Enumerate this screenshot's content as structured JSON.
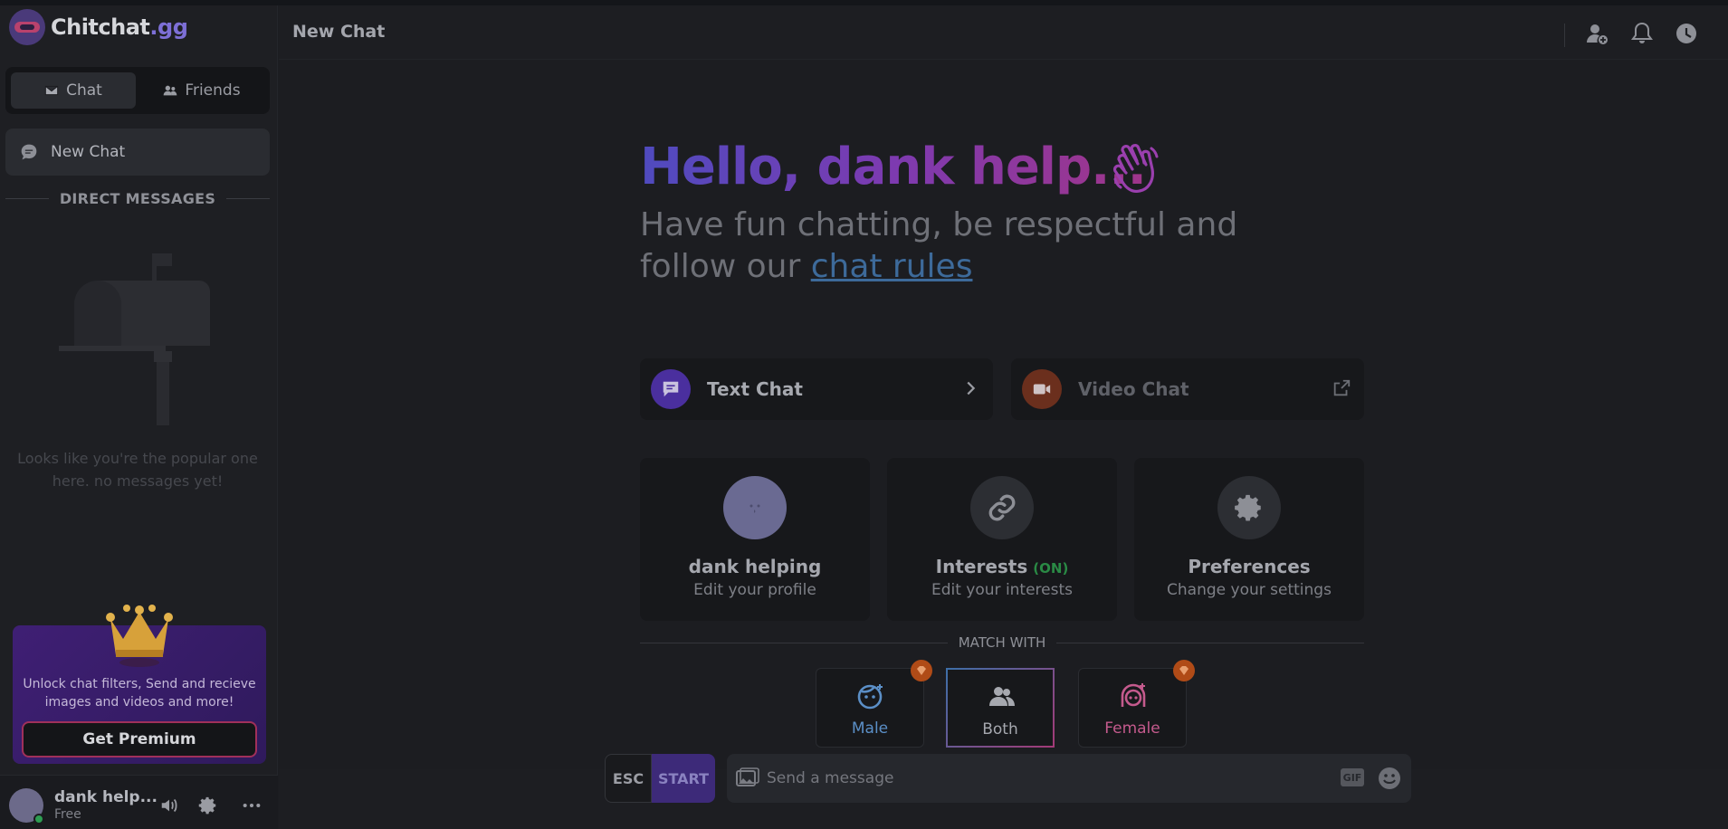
{
  "app": {
    "logo_main": "Chitchat",
    "logo_suffix": ".gg"
  },
  "sidebar": {
    "tabs": [
      {
        "label": "Chat",
        "icon": "envelope-icon",
        "active": true
      },
      {
        "label": "Friends",
        "icon": "users-icon",
        "active": false
      }
    ],
    "new_chat_label": "New Chat",
    "dm_heading": "DIRECT MESSAGES",
    "empty_text": "Looks like you're the popular one here. no messages yet!",
    "premium": {
      "text": "Unlock chat filters, Send and recieve images and videos and more!",
      "button_label": "Get Premium"
    },
    "user": {
      "name": "dank help...",
      "plan": "Free",
      "status": "online"
    }
  },
  "header": {
    "title": "New Chat"
  },
  "main": {
    "greeting": "Hello, dank help...",
    "subtitle_text": "Have fun chatting, be respectful and follow our ",
    "rules_link": "chat rules",
    "modes": [
      {
        "label": "Text Chat",
        "color": "#5a3bb4",
        "icon": "message-icon"
      },
      {
        "label": "Video Chat",
        "color": "#7a3420",
        "icon": "video-icon"
      }
    ],
    "options": [
      {
        "title": "dank helping",
        "subtitle": "Edit your profile",
        "icon": "avatar"
      },
      {
        "title": "Interests",
        "badge": "(ON)",
        "subtitle": "Edit your interests",
        "icon": "link-icon"
      },
      {
        "title": "Preferences",
        "subtitle": "Change your settings",
        "icon": "gear-icon"
      }
    ],
    "match_heading": "MATCH WITH",
    "genders": [
      {
        "label": "Male",
        "color": "#5b8fc7",
        "premium": true,
        "selected": false
      },
      {
        "label": "Both",
        "color": "#a6a8af",
        "premium": false,
        "selected": true
      },
      {
        "label": "Female",
        "color": "#c45a8d",
        "premium": true,
        "selected": false
      }
    ]
  },
  "composer": {
    "esc_label": "ESC",
    "start_label": "START",
    "placeholder": "Send a message",
    "gif_label": "GIF"
  }
}
